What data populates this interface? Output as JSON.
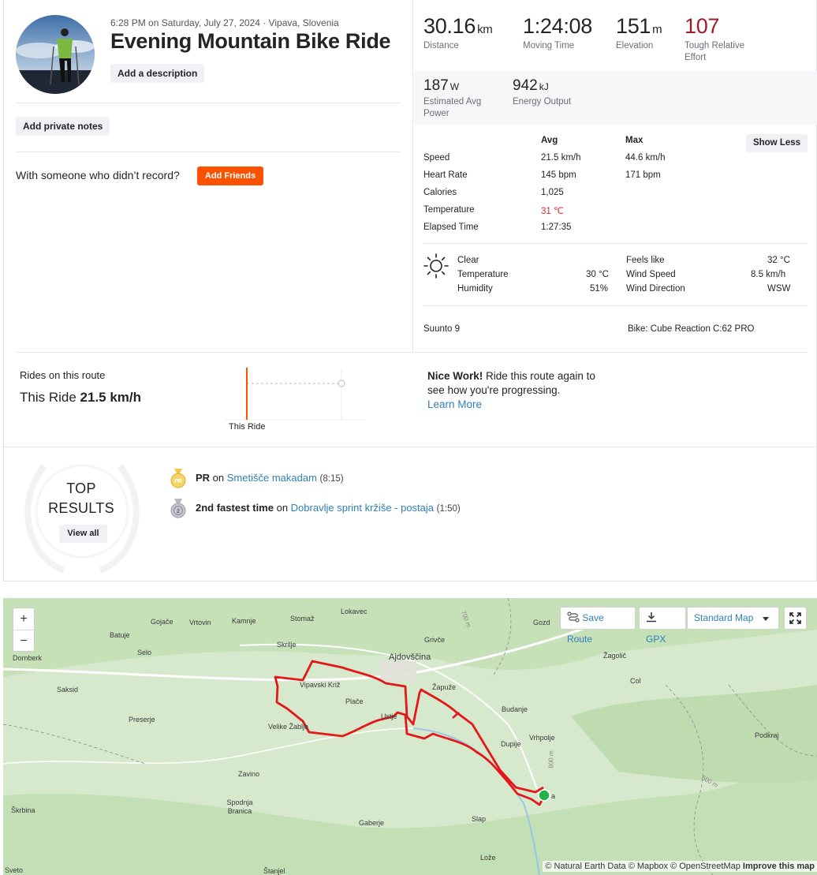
{
  "activity": {
    "meta": "6:28 PM on Saturday, July 27, 2024 · Vipava, Slovenia",
    "title": "Evening Mountain Bike Ride",
    "add_description": "Add a description",
    "add_private_notes": "Add private notes",
    "with_someone": "With someone who didn’t record?",
    "add_friends": "Add Friends"
  },
  "stats": {
    "distance": {
      "value": "30.16",
      "unit": "km",
      "label": "Distance"
    },
    "moving_time": {
      "value": "1:24:08",
      "label": "Moving Time"
    },
    "elevation": {
      "value": "151",
      "unit": "m",
      "label": "Elevation"
    },
    "effort": {
      "value": "107",
      "label_1": "Tough Relative",
      "label_2": "Effort"
    },
    "power": {
      "value": "187",
      "unit": "W",
      "label_1": "Estimated Avg",
      "label_2": "Power"
    },
    "energy": {
      "value": "942",
      "unit": "kJ",
      "label": "Energy Output"
    }
  },
  "details": {
    "avg_header": "Avg",
    "max_header": "Max",
    "show_less": "Show Less",
    "rows": [
      {
        "label": "Speed",
        "avg": "21.5 km/h",
        "max": "44.6 km/h"
      },
      {
        "label": "Heart Rate",
        "avg": "145 bpm",
        "max": "171 bpm"
      },
      {
        "label": "Calories",
        "avg": "1,025",
        "max": ""
      },
      {
        "label": "Temperature",
        "avg": "31 ℃",
        "max": ""
      },
      {
        "label": "Elapsed Time",
        "avg": "1:27:35",
        "max": ""
      }
    ]
  },
  "weather": {
    "icon": "sun-icon",
    "condition": "Clear",
    "temperature_label": "Temperature",
    "temperature": "30 °C",
    "humidity_label": "Humidity",
    "humidity": "51%",
    "feels_like_label": "Feels like",
    "feels_like": "32 °C",
    "wind_speed_label": "Wind Speed",
    "wind_speed": "8.5 km/h",
    "wind_direction_label": "Wind Direction",
    "wind_direction": "WSW"
  },
  "device": "Suunto 9",
  "bike": "Bike: Cube Reaction C:62 PRO",
  "route_compare": {
    "label": "Rides on this route",
    "this_ride_prefix": "This Ride",
    "this_ride_value": "21.5 km/h",
    "chart_label": "This Ride",
    "nice_bold": "Nice Work!",
    "nice_text": " Ride this route again to see how you're progressing.",
    "learn_more": "Learn More"
  },
  "top_results": {
    "title_1": "TOP",
    "title_2": "RESULTS",
    "view_all": "View all",
    "items": [
      {
        "badge": "PR",
        "prefix": "PR",
        "on": " on ",
        "segment": "Smetišče makadam",
        "time": "(8:15)"
      },
      {
        "badge": "2",
        "prefix": "2nd fastest time",
        "on": " on ",
        "segment": "Dobravlje sprint kržiše - postaja",
        "time": "(1:50)"
      }
    ]
  },
  "map": {
    "zoom_in": "+",
    "zoom_out": "−",
    "save_route": "Save Route",
    "gpx": "GPX",
    "map_type": "Standard Map",
    "attribution": "© Natural Earth Data © Mapbox © OpenStreetMap ",
    "attribution_bold": "Improve this map",
    "places": [
      {
        "name": "Lokavec"
      },
      {
        "name": "Gojače"
      },
      {
        "name": "Vrtovin"
      },
      {
        "name": "Kamnje"
      },
      {
        "name": "Stomaž"
      },
      {
        "name": "Batuje"
      },
      {
        "name": "Selo"
      },
      {
        "name": "Skrilje"
      },
      {
        "name": "Grivče"
      },
      {
        "name": "Gozd"
      },
      {
        "name": "Dornberk"
      },
      {
        "name": "Ajdovščina"
      },
      {
        "name": "Žagolič"
      },
      {
        "name": "Col"
      },
      {
        "name": "Vipavski Križ"
      },
      {
        "name": "Žapuže"
      },
      {
        "name": "Saksid"
      },
      {
        "name": "Plače"
      },
      {
        "name": "Budanje"
      },
      {
        "name": "Preserje"
      },
      {
        "name": "Ustje"
      },
      {
        "name": "Velike Žablje"
      },
      {
        "name": "Vrhpolje"
      },
      {
        "name": "Dupije"
      },
      {
        "name": "Podkraj"
      },
      {
        "name": "Zavino"
      },
      {
        "name": "Škrbina"
      },
      {
        "name": "Spodnja Branica"
      },
      {
        "name": "Gaberje"
      },
      {
        "name": "Slap"
      },
      {
        "name": "Lože"
      },
      {
        "name": "Sveto"
      },
      {
        "name": "Štanjel"
      },
      {
        "name": "a"
      }
    ],
    "contours": [
      "700 m",
      "800 m",
      "600 m"
    ]
  }
}
